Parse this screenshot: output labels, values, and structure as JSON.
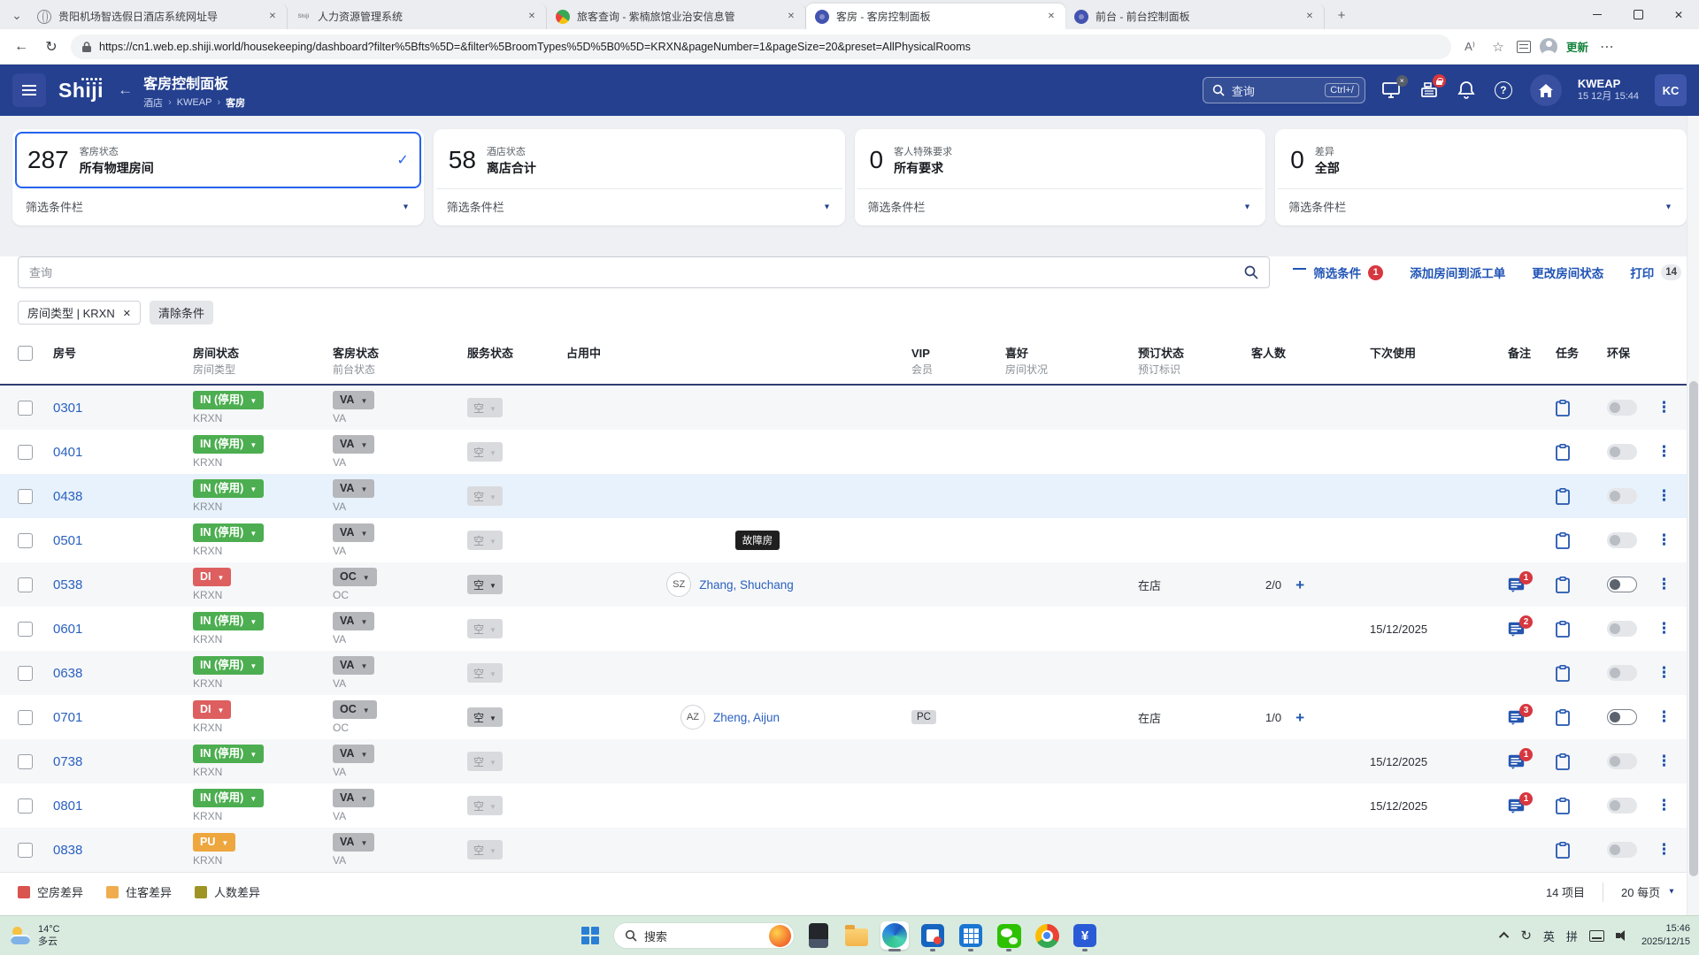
{
  "browser": {
    "tabs": [
      {
        "title": "贵阳机场智选假日酒店系统网址导",
        "icon": "globe",
        "active": false
      },
      {
        "title": "人力资源管理系统",
        "icon": "shiji",
        "active": false
      },
      {
        "title": "旅客查询 - 紫楠旅馆业治安信息管",
        "icon": "psb",
        "active": false
      },
      {
        "title": "客房 - 客房控制面板",
        "icon": "shiji-app",
        "active": true
      },
      {
        "title": "前台 - 前台控制面板",
        "icon": "shiji-app",
        "active": false
      }
    ],
    "url": "https://cn1.web.ep.shiji.world/housekeeping/dashboard?filter%5Bfts%5D=&filter%5BroomTypes%5D%5B0%5D=KRXN&pageNumber=1&pageSize=20&preset=AllPhysicalRooms",
    "update_label": "更新"
  },
  "header": {
    "logo": "Shiji",
    "title": "客房控制面板",
    "breadcrumb": [
      "酒店",
      "KWEAP",
      "客房"
    ],
    "search_placeholder": "查询",
    "shortcut": "Ctrl+/",
    "property": "KWEAP",
    "datetime": "15 12月 15:44",
    "avatar": "KC"
  },
  "cards": [
    {
      "value": "287",
      "category": "客房状态",
      "label": "所有物理房间",
      "selected": true,
      "filter": "筛选条件栏"
    },
    {
      "value": "58",
      "category": "酒店状态",
      "label": "离店合计",
      "selected": false,
      "filter": "筛选条件栏"
    },
    {
      "value": "0",
      "category": "客人特殊要求",
      "label": "所有要求",
      "selected": false,
      "filter": "筛选条件栏"
    },
    {
      "value": "0",
      "category": "差异",
      "label": "全部",
      "selected": false,
      "filter": "筛选条件栏"
    }
  ],
  "toolbar": {
    "search_placeholder": "查询",
    "filter": "筛选条件",
    "filter_badge": "1",
    "assign": "添加房间到派工单",
    "change_status": "更改房间状态",
    "print": "打印",
    "print_badge": "14"
  },
  "chips": {
    "type_filter": "房间类型 | KRXN",
    "clear": "清除条件"
  },
  "table": {
    "headers": {
      "room": "房号",
      "room_status": "房间状态",
      "room_type": "房间类型",
      "hk_status": "客房状态",
      "fo_status": "前台状态",
      "service": "服务状态",
      "occupied": "占用中",
      "vip": "VIP",
      "member": "会员",
      "pref": "喜好",
      "room_cond": "房间状况",
      "resv": "预订状态",
      "resv_flag": "预订标识",
      "guests": "客人数",
      "next_use": "下次使用",
      "notes": "备注",
      "tasks": "任务",
      "eco": "环保"
    },
    "rows": [
      {
        "room": "0301",
        "status": "IN (停用)",
        "kind": "in",
        "type": "KRXN",
        "fo": "VA",
        "fo_sub": "VA",
        "service": "空",
        "service_on": false,
        "fault": "",
        "initials": "",
        "guest": "",
        "vip": "",
        "resv": "",
        "count": "",
        "next": "",
        "notes": "",
        "eco": false,
        "highlight": false
      },
      {
        "room": "0401",
        "status": "IN (停用)",
        "kind": "in",
        "type": "KRXN",
        "fo": "VA",
        "fo_sub": "VA",
        "service": "空",
        "service_on": false,
        "fault": "",
        "initials": "",
        "guest": "",
        "vip": "",
        "resv": "",
        "count": "",
        "next": "",
        "notes": "",
        "eco": false,
        "highlight": false
      },
      {
        "room": "0438",
        "status": "IN (停用)",
        "kind": "in",
        "type": "KRXN",
        "fo": "VA",
        "fo_sub": "VA",
        "service": "空",
        "service_on": false,
        "fault": "",
        "initials": "",
        "guest": "",
        "vip": "",
        "resv": "",
        "count": "",
        "next": "",
        "notes": "",
        "eco": false,
        "highlight": true
      },
      {
        "room": "0501",
        "status": "IN (停用)",
        "kind": "in",
        "type": "KRXN",
        "fo": "VA",
        "fo_sub": "VA",
        "service": "空",
        "service_on": false,
        "fault": "故障房",
        "initials": "",
        "guest": "",
        "vip": "",
        "resv": "",
        "count": "",
        "next": "",
        "notes": "",
        "eco": false,
        "highlight": false
      },
      {
        "room": "0538",
        "status": "DI",
        "kind": "di",
        "type": "KRXN",
        "fo": "OC",
        "fo_sub": "OC",
        "service": "空",
        "service_on": true,
        "fault": "",
        "initials": "SZ",
        "guest": "Zhang, Shuchang",
        "vip": "",
        "resv": "在店",
        "count": "2/0",
        "next": "",
        "notes": "1",
        "eco": true,
        "highlight": false
      },
      {
        "room": "0601",
        "status": "IN (停用)",
        "kind": "in",
        "type": "KRXN",
        "fo": "VA",
        "fo_sub": "VA",
        "service": "空",
        "service_on": false,
        "fault": "",
        "initials": "",
        "guest": "",
        "vip": "",
        "resv": "",
        "count": "",
        "next": "15/12/2025",
        "notes": "2",
        "eco": false,
        "highlight": false
      },
      {
        "room": "0638",
        "status": "IN (停用)",
        "kind": "in",
        "type": "KRXN",
        "fo": "VA",
        "fo_sub": "VA",
        "service": "空",
        "service_on": false,
        "fault": "",
        "initials": "",
        "guest": "",
        "vip": "",
        "resv": "",
        "count": "",
        "next": "",
        "notes": "",
        "eco": false,
        "highlight": false
      },
      {
        "room": "0701",
        "status": "DI",
        "kind": "di",
        "type": "KRXN",
        "fo": "OC",
        "fo_sub": "OC",
        "service": "空",
        "service_on": true,
        "fault": "",
        "initials": "AZ",
        "guest": "Zheng, Aijun",
        "vip": "PC",
        "resv": "在店",
        "count": "1/0",
        "next": "",
        "notes": "3",
        "eco": true,
        "highlight": false
      },
      {
        "room": "0738",
        "status": "IN (停用)",
        "kind": "in",
        "type": "KRXN",
        "fo": "VA",
        "fo_sub": "VA",
        "service": "空",
        "service_on": false,
        "fault": "",
        "initials": "",
        "guest": "",
        "vip": "",
        "resv": "",
        "count": "",
        "next": "15/12/2025",
        "notes": "1",
        "eco": false,
        "highlight": false
      },
      {
        "room": "0801",
        "status": "IN (停用)",
        "kind": "in",
        "type": "KRXN",
        "fo": "VA",
        "fo_sub": "VA",
        "service": "空",
        "service_on": false,
        "fault": "",
        "initials": "",
        "guest": "",
        "vip": "",
        "resv": "",
        "count": "",
        "next": "15/12/2025",
        "notes": "1",
        "eco": false,
        "highlight": false
      },
      {
        "room": "0838",
        "status": "PU",
        "kind": "pu",
        "type": "KRXN",
        "fo": "VA",
        "fo_sub": "VA",
        "service": "空",
        "service_on": false,
        "fault": "",
        "initials": "",
        "guest": "",
        "vip": "",
        "resv": "",
        "count": "",
        "next": "",
        "notes": "",
        "eco": false,
        "highlight": false
      }
    ]
  },
  "legend": {
    "items": [
      {
        "label": "空房差异",
        "color": "#d9534f"
      },
      {
        "label": "住客差异",
        "color": "#f0ad4e"
      },
      {
        "label": "人数差异",
        "color": "#9d9423"
      }
    ]
  },
  "pagination": {
    "total": "14 项目",
    "per_page": "20 每页"
  },
  "taskbar": {
    "weather_temp": "14°C",
    "weather_cond": "多云",
    "search_placeholder": "搜索",
    "apps": [
      {
        "id": "photos",
        "name": "photos-icon",
        "running": false,
        "active": false
      },
      {
        "id": "folder",
        "name": "file-explorer-icon",
        "running": false,
        "active": false
      },
      {
        "id": "edge",
        "name": "edge-icon",
        "running": true,
        "active": true
      },
      {
        "id": "app1",
        "name": "app-icon-blue-red",
        "running": true,
        "active": false
      },
      {
        "id": "grid",
        "name": "app-icon-grid",
        "running": true,
        "active": false
      },
      {
        "id": "wechat",
        "name": "wechat-icon",
        "running": true,
        "active": false
      },
      {
        "id": "chrome",
        "name": "chrome-icon",
        "running": false,
        "active": false
      },
      {
        "id": "finance",
        "name": "finance-app-icon",
        "running": true,
        "active": false
      }
    ],
    "lang1": "英",
    "lang2": "拼",
    "time": "15:46",
    "date": "2025/12/15"
  }
}
